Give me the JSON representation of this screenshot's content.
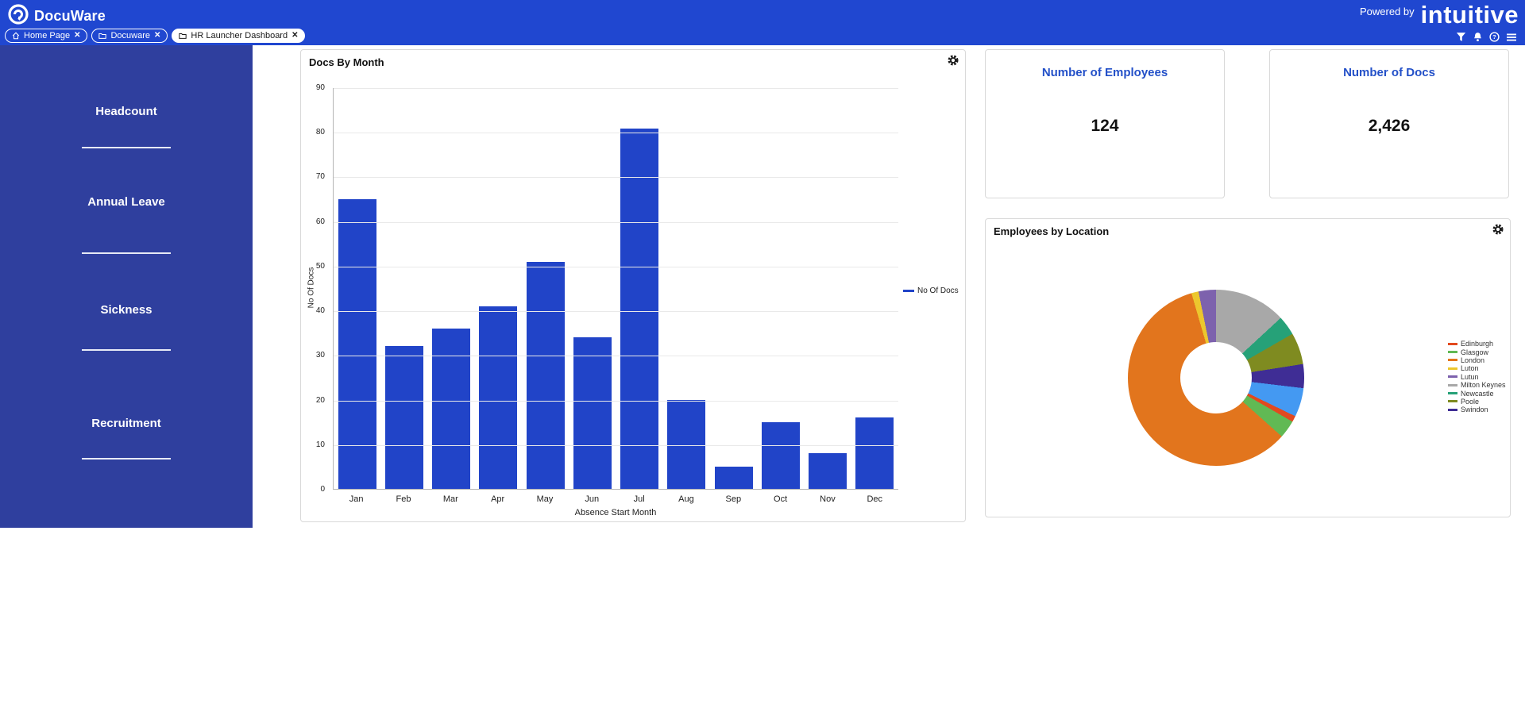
{
  "header": {
    "brand": "DocuWare",
    "powered_by_label": "Powered by",
    "powered_by_brand": "intuitive"
  },
  "tabs": [
    {
      "label": "Home Page",
      "icon": "home-icon",
      "active": false
    },
    {
      "label": "Docuware",
      "icon": "folder-icon",
      "active": false
    },
    {
      "label": "HR Launcher Dashboard",
      "icon": "folder-icon",
      "active": true
    }
  ],
  "toolbar_icons": [
    "filter-icon",
    "bell-icon",
    "help-icon",
    "menu-icon"
  ],
  "sidebar": {
    "items": [
      {
        "label": "Headcount"
      },
      {
        "label": "Annual Leave"
      },
      {
        "label": "Sickness"
      },
      {
        "label": "Recruitment"
      }
    ]
  },
  "stat_cards": [
    {
      "title": "Number of Employees",
      "value": "124"
    },
    {
      "title": "Number of Docs",
      "value": "2,426"
    }
  ],
  "colors": {
    "header_bg": "#2047d0",
    "sidebar_bg": "#2f3f9e",
    "accent_blue": "#2144c8",
    "stat_title_blue": "#2350c8"
  },
  "chart_data": [
    {
      "type": "bar",
      "title": "Docs By Month",
      "categories": [
        "Jan",
        "Feb",
        "Mar",
        "Apr",
        "May",
        "Jun",
        "Jul",
        "Aug",
        "Sep",
        "Oct",
        "Nov",
        "Dec"
      ],
      "values": [
        65,
        32,
        36,
        41,
        51,
        34,
        81,
        20,
        5,
        15,
        8,
        16
      ],
      "xlabel": "Absence Start Month",
      "ylabel": "No Of Docs",
      "ylim": [
        0,
        90
      ],
      "ytick_step": 10,
      "grid": true,
      "legend_position": "right",
      "legend": [
        {
          "name": "No Of Docs",
          "color": "#2144c8"
        }
      ],
      "bar_color": "#2144c8"
    },
    {
      "type": "pie",
      "donut": true,
      "title": "Employees by Location",
      "legend_position": "right",
      "legend": [
        {
          "name": "Edinburgh",
          "color": "#e2491f"
        },
        {
          "name": "Glasgow",
          "color": "#61b954"
        },
        {
          "name": "London",
          "color": "#e2751d"
        },
        {
          "name": "Luton",
          "color": "#ecc72e"
        },
        {
          "name": "Lutun",
          "color": "#7d62ad"
        },
        {
          "name": "Milton Keynes",
          "color": "#a8a8a8"
        },
        {
          "name": "Newcastle",
          "color": "#26a178"
        },
        {
          "name": "Poole",
          "color": "#7f8b20"
        },
        {
          "name": "Swindon",
          "color": "#3f2d95"
        }
      ],
      "slices_clockwise_from_top": [
        {
          "label": "Milton Keynes",
          "color": "#a8a8a8",
          "percent": 13.1
        },
        {
          "label": "Newcastle",
          "color": "#26a178",
          "percent": 3.6
        },
        {
          "label": "Poole",
          "color": "#7f8b20",
          "percent": 5.8
        },
        {
          "label": "Swindon",
          "color": "#3f2d95",
          "percent": 4.4
        },
        {
          "label": "",
          "color": "#4499f2",
          "percent": 5.3
        },
        {
          "label": "Edinburgh",
          "color": "#e2491f",
          "percent": 1.1
        },
        {
          "label": "Glasgow",
          "color": "#61b954",
          "percent": 3.3
        },
        {
          "label": "London",
          "color": "#e2751d",
          "percent": 58.9
        },
        {
          "label": "Luton",
          "color": "#ecc72e",
          "percent": 1.3
        },
        {
          "label": "Lutun",
          "color": "#7d62ad",
          "percent": 3.2
        }
      ]
    }
  ]
}
